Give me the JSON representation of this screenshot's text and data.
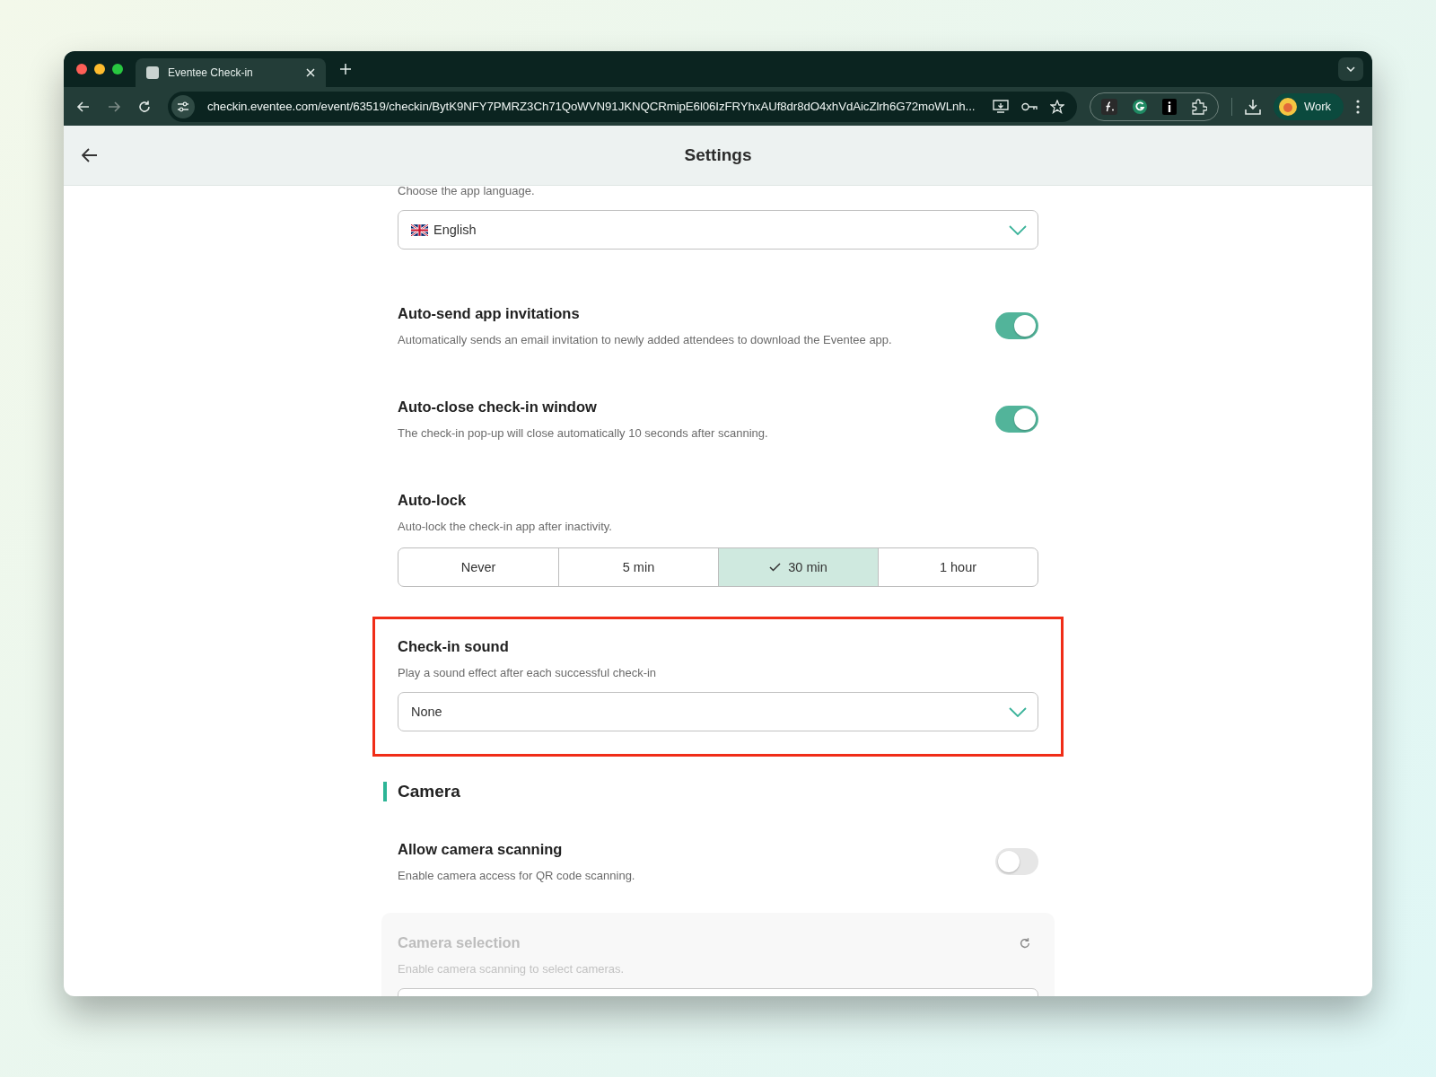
{
  "browser": {
    "tabs": [
      {
        "title": "Eventee Check-in",
        "selected": true
      }
    ],
    "url": "checkin.eventee.com/event/63519/checkin/BytK9NFY7PMRZ3Ch71QoWVN91JKNQCRmipE6l06IzFRYhxAUf8dr8dO4xhVdAicZlrh6G72moWLnh...",
    "profile": "Work"
  },
  "header": {
    "title": "Settings"
  },
  "items": [
    {
      "kind": "select",
      "highlighted": false,
      "description": "Choose the app language.",
      "value": "English"
    },
    {
      "kind": "toggle",
      "title": "Auto-send app invitations",
      "description": "Automatically sends an email invitation to newly added attendees to download the Eventee app.",
      "on": true
    },
    {
      "kind": "toggle",
      "title": "Auto-close check-in window",
      "description": "The check-in pop-up will close automatically 10 seconds after scanning.",
      "on": true
    },
    {
      "kind": "segmented",
      "title": "Auto-lock",
      "description": "Auto-lock the check-in app after inactivity.",
      "options": [
        {
          "label": "Never",
          "selected": false
        },
        {
          "label": "5 min",
          "selected": false
        },
        {
          "label": "30 min",
          "selected": true
        },
        {
          "label": "1 hour",
          "selected": false
        }
      ]
    },
    {
      "kind": "select",
      "highlighted": true,
      "title": "Check-in sound",
      "description": "Play a sound effect after each successful check-in",
      "value": "None"
    },
    {
      "kind": "section",
      "title": "Camera"
    },
    {
      "kind": "toggle",
      "title": "Allow camera scanning",
      "description": "Enable camera access for QR code scanning.",
      "on": false
    },
    {
      "kind": "panel",
      "title": "Camera selection",
      "description": "Enable camera scanning to select cameras.",
      "disabled": true
    }
  ]
}
